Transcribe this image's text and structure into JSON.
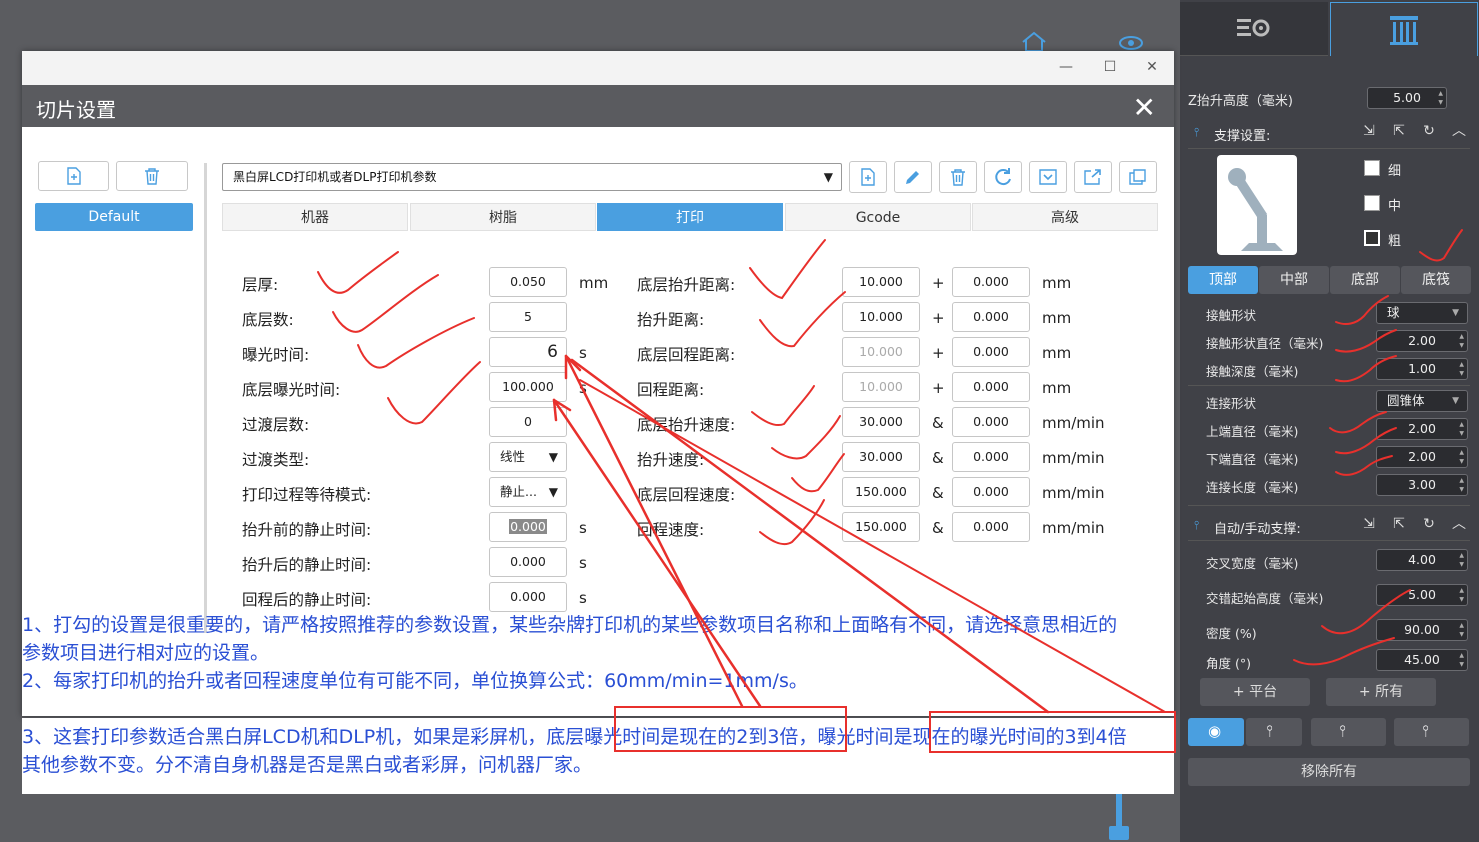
{
  "right_panel": {
    "z_lift_label": "Z抬升高度（毫米)",
    "z_lift_value": "5.00",
    "support_settings_title": "支撑设置:",
    "size_options": [
      "细",
      "中",
      "粗"
    ],
    "segments": [
      "顶部",
      "中部",
      "底部",
      "底筏"
    ],
    "contact": [
      {
        "label": "接触形状",
        "value": "球",
        "type": "select"
      },
      {
        "label": "接触形状直径（毫米)",
        "value": "2.00",
        "type": "spin"
      },
      {
        "label": "接触深度（毫米)",
        "value": "1.00",
        "type": "spin"
      }
    ],
    "connect": [
      {
        "label": "连接形状",
        "value": "圆锥体",
        "type": "select"
      },
      {
        "label": "上端直径（毫米)",
        "value": "2.00",
        "type": "spin"
      },
      {
        "label": "下端直径（毫米)",
        "value": "2.00",
        "type": "spin"
      },
      {
        "label": "连接长度（毫米)",
        "value": "3.00",
        "type": "spin"
      }
    ],
    "auto_support_title": "自动/手动支撑:",
    "auto": [
      {
        "label": "交叉宽度（毫米)",
        "value": "4.00"
      },
      {
        "label": "交错起始高度（毫米)",
        "value": "5.00"
      },
      {
        "label": "密度 (%)",
        "value": "90.00"
      },
      {
        "label": "角度 (°)",
        "value": "45.00"
      }
    ],
    "add_platform": "+ 平台",
    "add_all": "+ 所有",
    "remove_all": "移除所有"
  },
  "dialog": {
    "title": "切片设置",
    "profile_name": "Default",
    "printer_combo": "黑白屏LCD打印机或者DLP打印机参数",
    "tabs": [
      "机器",
      "树脂",
      "打印",
      "Gcode",
      "高级"
    ],
    "active_tab": "打印",
    "left_params": [
      {
        "label": "层厚:",
        "value": "0.050",
        "unit": "mm"
      },
      {
        "label": "底层数:",
        "value": "5",
        "unit": ""
      },
      {
        "label": "曝光时间:",
        "value": "6",
        "unit": "s"
      },
      {
        "label": "底层曝光时间:",
        "value": "100.000",
        "unit": "s"
      },
      {
        "label": "过渡层数:",
        "value": "0",
        "unit": ""
      },
      {
        "label": "过渡类型:",
        "value": "线性",
        "unit": ""
      },
      {
        "label": "打印过程等待模式:",
        "value": "静止...",
        "unit": ""
      },
      {
        "label": "抬升前的静止时间:",
        "value": "0.000",
        "unit": "s"
      },
      {
        "label": "抬升后的静止时间:",
        "value": "0.000",
        "unit": "s"
      },
      {
        "label": "回程后的静止时间:",
        "value": "0.000",
        "unit": "s"
      }
    ],
    "right_params": [
      {
        "label": "底层抬升距离:",
        "v1": "10.000",
        "sep": "+",
        "v2": "0.000",
        "unit": "mm"
      },
      {
        "label": "抬升距离:",
        "v1": "10.000",
        "sep": "+",
        "v2": "0.000",
        "unit": "mm"
      },
      {
        "label": "底层回程距离:",
        "v1": "10.000",
        "sep": "+",
        "v2": "0.000",
        "unit": "mm"
      },
      {
        "label": "回程距离:",
        "v1": "10.000",
        "sep": "+",
        "v2": "0.000",
        "unit": "mm"
      },
      {
        "label": "底层抬升速度:",
        "v1": "30.000",
        "sep": "&",
        "v2": "0.000",
        "unit": "mm/min"
      },
      {
        "label": "抬升速度:",
        "v1": "30.000",
        "sep": "&",
        "v2": "0.000",
        "unit": "mm/min"
      },
      {
        "label": "底层回程速度:",
        "v1": "150.000",
        "sep": "&",
        "v2": "0.000",
        "unit": "mm/min"
      },
      {
        "label": "回程速度:",
        "v1": "150.000",
        "sep": "&",
        "v2": "0.000",
        "unit": "mm/min"
      }
    ]
  },
  "notes": {
    "line1": "1、打勾的设置是很重要的，请严格按照推荐的参数设置，某些杂牌打印机的某些参数项目名称和上面略有不同，请选择意思相近的",
    "line2": "参数项目进行相对应的设置。",
    "line3": "2、每家打印机的抬升或者回程速度单位有可能不同，单位换算公式：60mm/min=1mm/s。",
    "line4_a": "3、这套打印参数适合黑白屏LCD机和DLP机，如果是彩屏机，底层",
    "line4_b": "曝光时间是现在的2到3倍，",
    "line4_c": "曝光时间",
    "line4_d": "是现在的曝光时间的3到4倍",
    "line5": "其他参数不变。分不清自身机器是否是黑白或者彩屏，问机器厂家。"
  },
  "colors": {
    "accent": "#4a9fe0",
    "annotation_blue": "#2a4fd4",
    "annotation_red": "#e8302c"
  }
}
